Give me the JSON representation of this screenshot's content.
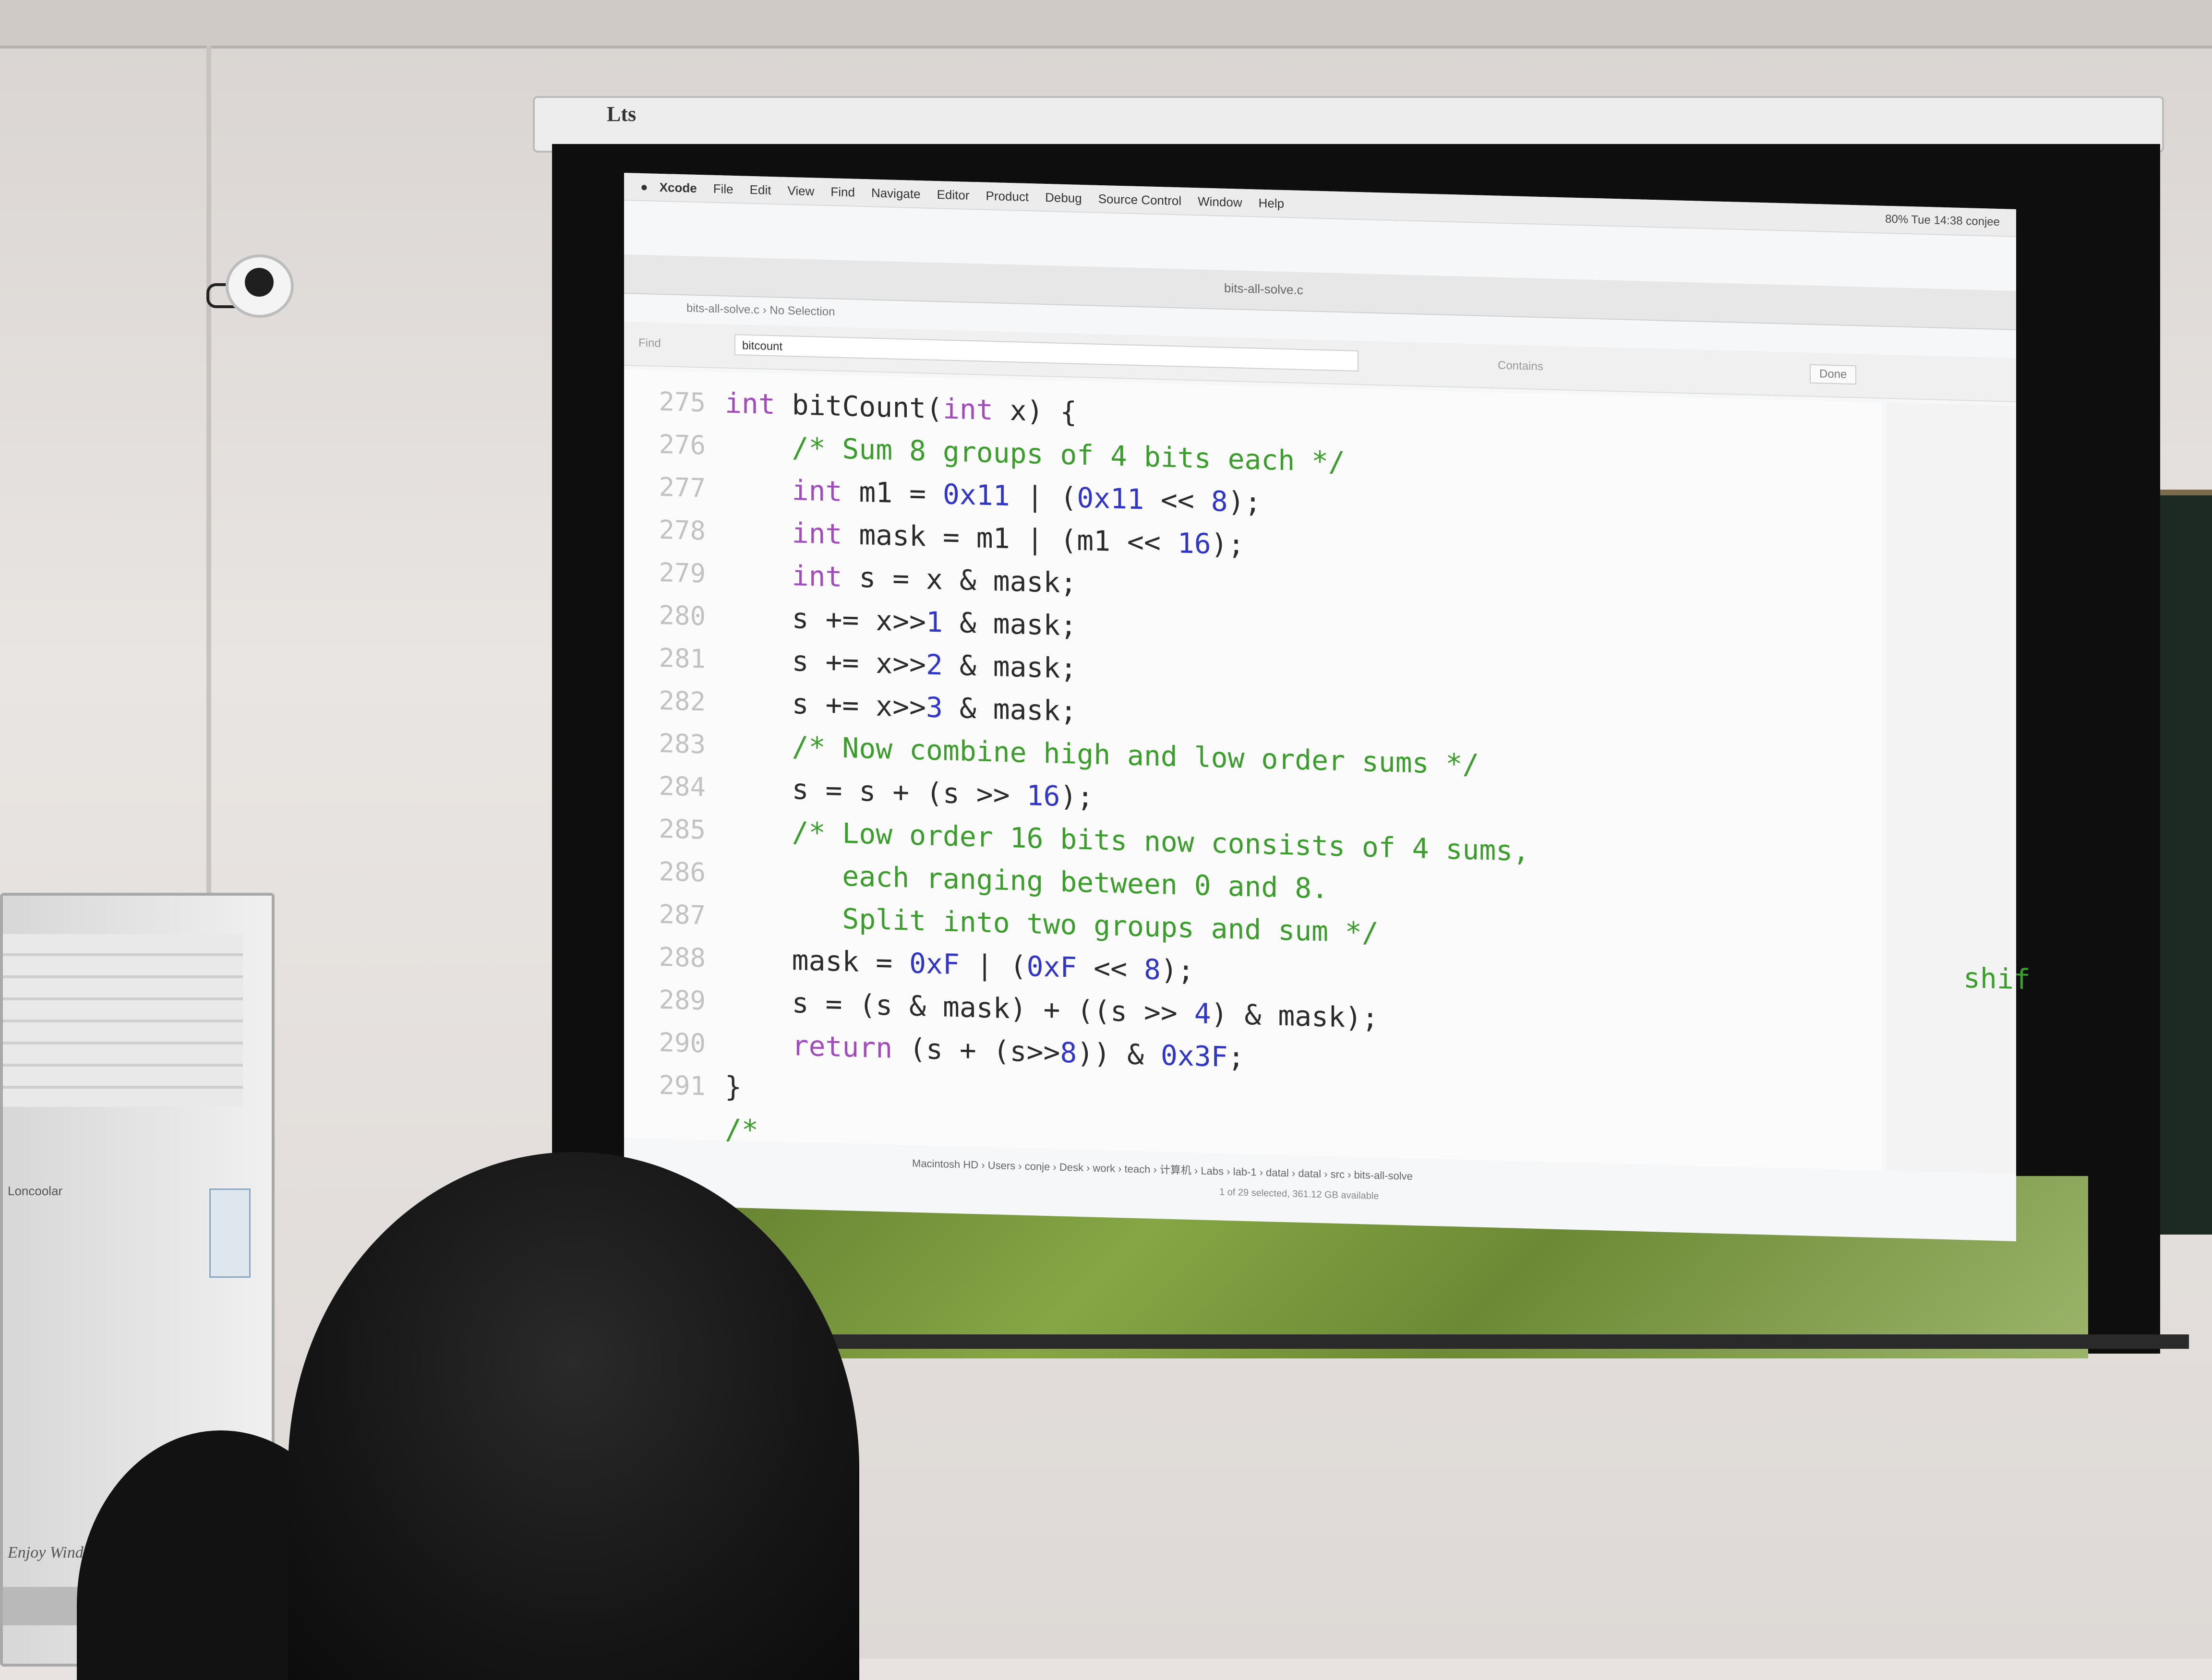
{
  "projector": {
    "brand": "Lts"
  },
  "menubar": {
    "app_name": "Xcode",
    "items": [
      "File",
      "Edit",
      "View",
      "Find",
      "Navigate",
      "Editor",
      "Product",
      "Debug",
      "Source Control",
      "Window",
      "Help"
    ],
    "status": "80%  Tue 14:38  conjee"
  },
  "window": {
    "title": "bits-all-solve.c"
  },
  "jump_bar": "bits-all-solve.c  ›  No Selection",
  "find_bar": {
    "label": "Find",
    "query": "bitcount",
    "matches": "Contains",
    "done_label": "Done"
  },
  "code_lines": [
    {
      "num": "275",
      "tokens": [
        [
          "kw",
          "int"
        ],
        [
          "txt",
          " bitCount("
        ],
        [
          "kw",
          "int"
        ],
        [
          "txt",
          " x) {"
        ]
      ]
    },
    {
      "num": "276",
      "tokens": [
        [
          "cm",
          "    /* Sum 8 groups of 4 bits each */"
        ]
      ]
    },
    {
      "num": "277",
      "tokens": [
        [
          "kw",
          "    int"
        ],
        [
          "txt",
          " m1 = "
        ],
        [
          "num",
          "0x11"
        ],
        [
          "txt",
          " | ("
        ],
        [
          "num",
          "0x11"
        ],
        [
          "txt",
          " << "
        ],
        [
          "num",
          "8"
        ],
        [
          "txt",
          ");"
        ]
      ]
    },
    {
      "num": "278",
      "tokens": [
        [
          "kw",
          "    int"
        ],
        [
          "txt",
          " mask = m1 | (m1 << "
        ],
        [
          "num",
          "16"
        ],
        [
          "txt",
          ");"
        ]
      ]
    },
    {
      "num": "279",
      "tokens": [
        [
          "kw",
          "    int"
        ],
        [
          "txt",
          " s = x & mask;"
        ]
      ]
    },
    {
      "num": "280",
      "tokens": [
        [
          "txt",
          "    s += x>>"
        ],
        [
          "num",
          "1"
        ],
        [
          "txt",
          " & mask;"
        ]
      ]
    },
    {
      "num": "281",
      "tokens": [
        [
          "txt",
          "    s += x>>"
        ],
        [
          "num",
          "2"
        ],
        [
          "txt",
          " & mask;"
        ]
      ]
    },
    {
      "num": "282",
      "tokens": [
        [
          "txt",
          "    s += x>>"
        ],
        [
          "num",
          "3"
        ],
        [
          "txt",
          " & mask;"
        ]
      ]
    },
    {
      "num": "283",
      "tokens": [
        [
          "cm",
          "    /* Now combine high and low order sums */"
        ]
      ]
    },
    {
      "num": "284",
      "tokens": [
        [
          "txt",
          "    s = s + (s >> "
        ],
        [
          "num",
          "16"
        ],
        [
          "txt",
          ");"
        ]
      ]
    },
    {
      "num": "285",
      "tokens": [
        [
          "cm",
          "    /* Low order 16 bits now consists of 4 sums,"
        ]
      ]
    },
    {
      "num": "286",
      "tokens": [
        [
          "cm",
          "       each ranging between 0 and 8."
        ]
      ]
    },
    {
      "num": "287",
      "tokens": [
        [
          "cm",
          "       Split into two groups and sum */"
        ]
      ]
    },
    {
      "num": "288",
      "tokens": [
        [
          "txt",
          "    mask = "
        ],
        [
          "num",
          "0xF"
        ],
        [
          "txt",
          " | ("
        ],
        [
          "num",
          "0xF"
        ],
        [
          "txt",
          " << "
        ],
        [
          "num",
          "8"
        ],
        [
          "txt",
          ");"
        ]
      ]
    },
    {
      "num": "289",
      "tokens": [
        [
          "txt",
          "    s = (s & mask) + ((s >> "
        ],
        [
          "num",
          "4"
        ],
        [
          "txt",
          ") & mask);"
        ]
      ]
    },
    {
      "num": "290",
      "tokens": [
        [
          "kw",
          "    return"
        ],
        [
          "txt",
          " (s + (s>>"
        ],
        [
          "num",
          "8"
        ],
        [
          "txt",
          ")) & "
        ],
        [
          "num",
          "0x3F"
        ],
        [
          "txt",
          ";"
        ]
      ]
    },
    {
      "num": "291",
      "tokens": [
        [
          "txt",
          "}"
        ]
      ]
    },
    {
      "num": "",
      "tokens": [
        [
          "cm",
          "/*"
        ]
      ]
    }
  ],
  "side_panel": {
    "partial_text": "shif"
  },
  "finder": {
    "path": "Macintosh HD › Users › conje › Desk › work › teach › 计算机 › Labs › lab-1 › datal › datal › src › bits-all-solve",
    "status": "1 of 29 selected, 361.12 GB available"
  },
  "aircon": {
    "brand_top": "Loncoolar",
    "brand": "Enjoy Wind 酷风"
  },
  "colors": {
    "keyword": "#a24bbd",
    "number": "#2f36c9",
    "comment": "#3a9e2b",
    "text": "#2b2b2b",
    "line_number": "#c2c2c2"
  }
}
